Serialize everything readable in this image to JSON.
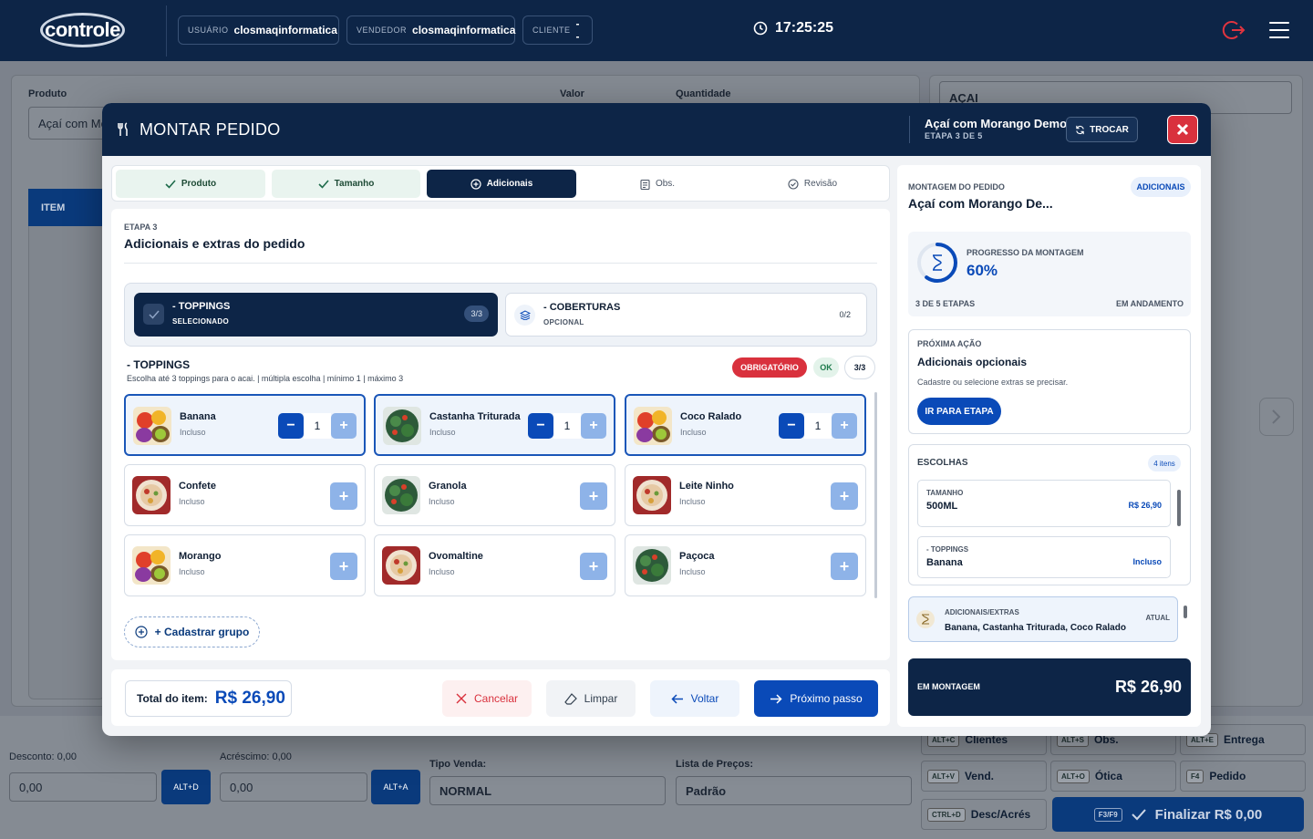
{
  "topbar": {
    "logo": "controle",
    "user_key": "USUÁRIO",
    "user_val": "closmaqinformatica",
    "seller_key": "VENDEDOR",
    "seller_val": "closmaqinformatica",
    "client_key": "CLIENTE",
    "client_val": "--",
    "clock": "17:25:25"
  },
  "background": {
    "produto_label": "Produto",
    "produto_value": "Açaí com Mo",
    "valor_label": "Valor",
    "quantidade_label": "Quantidade",
    "category_select": "AÇAI",
    "item_header": "ITEM",
    "desconto_label": "Desconto: 0,00",
    "desconto_value": "0,00",
    "alt_d": "ALT+D",
    "acrescimo_label": "Acréscimo: 0,00",
    "acrescimo_value": "0,00",
    "alt_a": "ALT+A",
    "tipo_venda_label": "Tipo Venda:",
    "tipo_venda_value": "NORMAL",
    "lista_label": "Lista de Preços:",
    "lista_value": "Padrão",
    "shortcuts": [
      {
        "key": "ALT+C",
        "label": "Clientes"
      },
      {
        "key": "ALT+S",
        "label": "Obs."
      },
      {
        "key": "ALT+E",
        "label": "Entrega"
      },
      {
        "key": "ALT+V",
        "label": "Vend."
      },
      {
        "key": "ALT+O",
        "label": "Ótica"
      },
      {
        "key": "F4",
        "label": "Pedido"
      },
      {
        "key": "CTRL+D",
        "label": "Desc/Acrés"
      }
    ],
    "finalizar_key": "F3/F9",
    "finalizar_label": "Finalizar R$ 0,00"
  },
  "modal": {
    "title": "MONTAR PEDIDO",
    "product": "Açaí com Morango Demo",
    "step": "ETAPA 3 DE 5",
    "trocar": "TROCAR",
    "tabs": [
      {
        "label": "Produto",
        "state": "done"
      },
      {
        "label": "Tamanho",
        "state": "done"
      },
      {
        "label": "Adicionais",
        "state": "active"
      },
      {
        "label": "Obs.",
        "state": "todo"
      },
      {
        "label": "Revisão",
        "state": "todo"
      }
    ],
    "etapa_key": "ETAPA 3",
    "etapa_title": "Adicionais e extras do pedido",
    "groups": [
      {
        "name": "- TOPPINGS",
        "sub": "SELECIONADO",
        "count": "3/3"
      },
      {
        "name": "- COBERTURAS",
        "sub": "OPCIONAL",
        "count": "0/2"
      }
    ],
    "section_title": "- TOPPINGS",
    "section_desc": "Escolha até 3 toppings para o acai. | múltipla escolha | mínimo 1 | máximo 3",
    "badge_req": "OBRIGATÓRIO",
    "badge_ok": "OK",
    "badge_count": "3/3",
    "items": [
      {
        "name": "Banana",
        "sub": "Incluso",
        "qty": "1",
        "img": "fruit"
      },
      {
        "name": "Castanha Triturada",
        "sub": "Incluso",
        "qty": "1",
        "img": "greens"
      },
      {
        "name": "Coco Ralado",
        "sub": "Incluso",
        "qty": "1",
        "img": "fruit"
      },
      {
        "name": "Confete",
        "sub": "Incluso",
        "img": "bowl"
      },
      {
        "name": "Granola",
        "sub": "Incluso",
        "img": "greens"
      },
      {
        "name": "Leite Ninho",
        "sub": "Incluso",
        "img": "bowl"
      },
      {
        "name": "Morango",
        "sub": "Incluso",
        "img": "fruit"
      },
      {
        "name": "Ovomaltine",
        "sub": "Incluso",
        "img": "bowl"
      },
      {
        "name": "Paçoca",
        "sub": "Incluso",
        "img": "greens"
      }
    ],
    "cadastrar": "+ Cadastrar grupo",
    "total_label": "Total do item:",
    "total_value": "R$ 26,90",
    "btn_cancel": "Cancelar",
    "btn_clear": "Limpar",
    "btn_back": "Voltar",
    "btn_next": "Próximo passo"
  },
  "summary": {
    "key": "MONTAGEM DO PEDIDO",
    "title": "Açaí com Morango De...",
    "badge": "ADICIONAIS",
    "progress_key": "PROGRESSO DA MONTAGEM",
    "progress_value": "60%",
    "progress_fraction": 0.6,
    "steps": "3 DE 5 ETAPAS",
    "status": "EM ANDAMENTO",
    "next_key": "PRÓXIMA AÇÃO",
    "next_title": "Adicionais opcionais",
    "next_desc": "Cadastre ou selecione extras se precisar.",
    "next_btn": "IR PARA ETAPA",
    "choices_key": "ESCOLHAS",
    "choices_count": "4 itens",
    "choices": [
      {
        "group": "TAMANHO",
        "value": "500ML",
        "price": "R$ 26,90"
      },
      {
        "group": "- TOPPINGS",
        "value": "Banana",
        "price": "Incluso"
      }
    ],
    "current_key": "ADICIONAIS/EXTRAS",
    "current_value": "Banana, Castanha Triturada, Coco Ralado",
    "current_tag": "ATUAL",
    "total_key": "EM MONTAGEM",
    "total_value": "R$ 26,90"
  }
}
